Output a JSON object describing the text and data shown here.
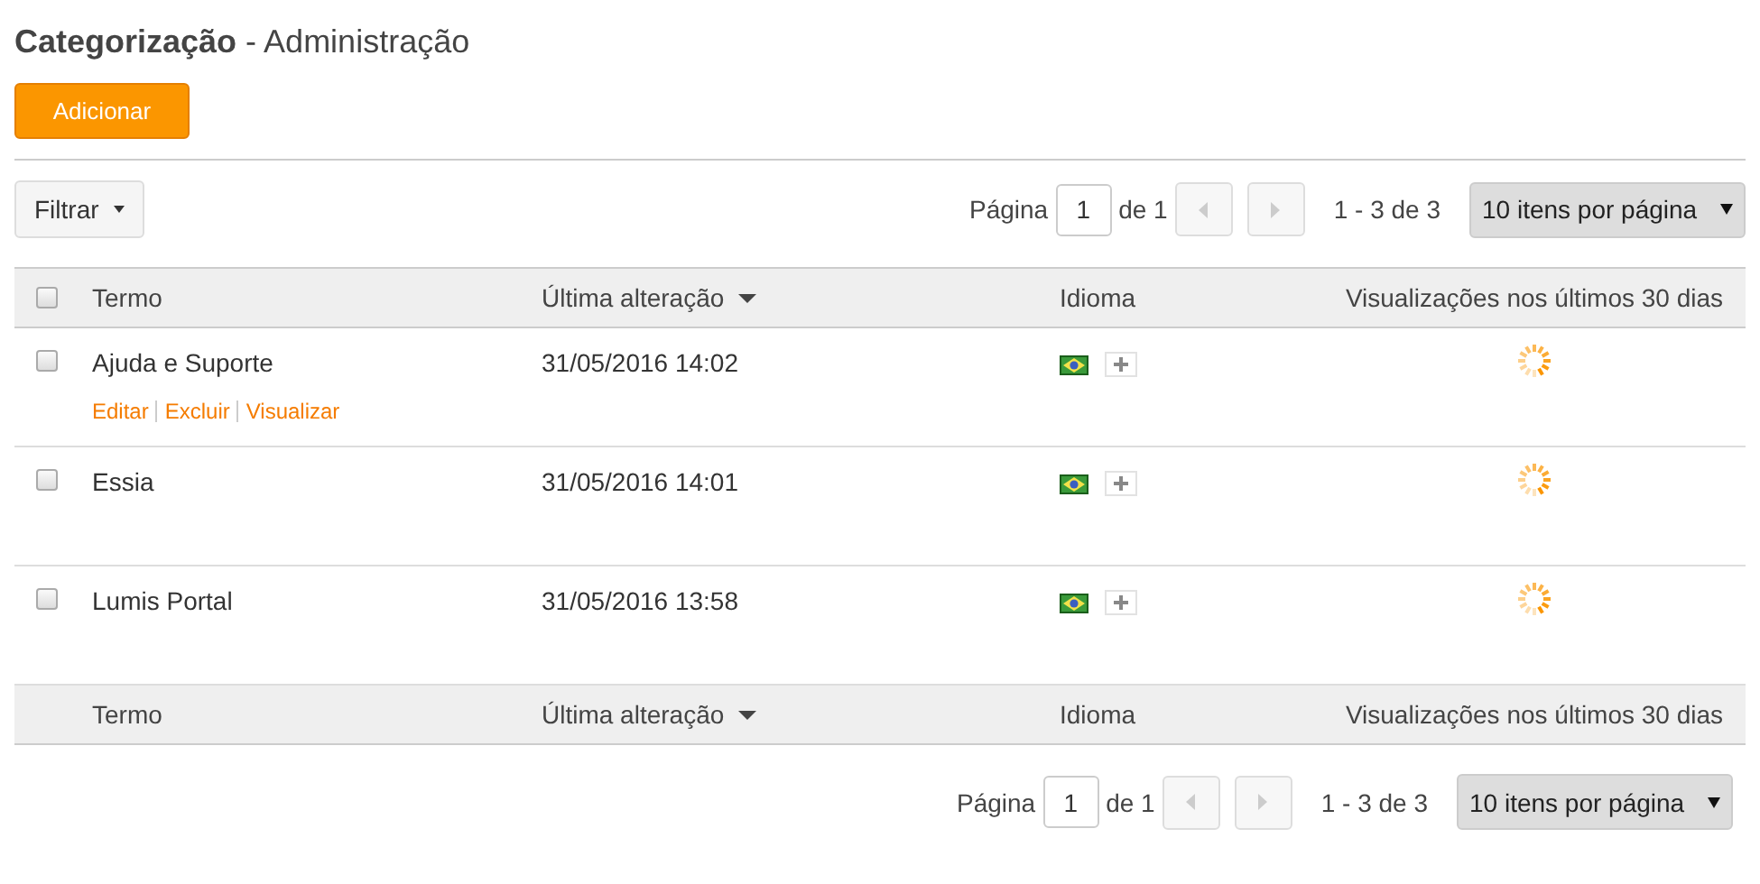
{
  "title": {
    "main": "Categorização",
    "sub": "- Administração"
  },
  "add_button": "Adicionar",
  "filter_button": "Filtrar",
  "pagination_top": {
    "label": "Página",
    "page": "1",
    "of": "de 1",
    "prev_disabled": true,
    "next_disabled": true,
    "range": "1 - 3 de 3",
    "per_page": "10 itens por página"
  },
  "table": {
    "select_all_checked": false,
    "columns": [
      {
        "label": "Termo",
        "sorted": false
      },
      {
        "label": "Última alteração",
        "sorted": true
      },
      {
        "label": "Idioma",
        "sorted": false
      },
      {
        "label": "Visualizações nos últimos 30 dias",
        "sorted": false
      }
    ],
    "rows": [
      {
        "checked": false,
        "term": "Ajuda e Suporte",
        "modified": "31/05/2016 14:02",
        "actions": [
          "Editar",
          "Excluir",
          "Visualizar"
        ]
      },
      {
        "checked": false,
        "term": "Essia",
        "modified": "31/05/2016 14:01"
      },
      {
        "checked": false,
        "term": "Lumis Portal",
        "modified": "31/05/2016 13:58"
      }
    ],
    "footer_columns": [
      {
        "label": "Termo",
        "sorted": false
      },
      {
        "label": "Última alteração",
        "sorted": true
      },
      {
        "label": "Idioma",
        "sorted": false
      },
      {
        "label": "Visualizações nos últimos 30 dias",
        "sorted": false
      }
    ]
  },
  "pagination_bottom": {
    "label": "Página",
    "page": "1",
    "of": "de 1",
    "prev_disabled": true,
    "next_disabled": true,
    "range": "1 - 3 de 3",
    "per_page": "10 itens por página"
  }
}
